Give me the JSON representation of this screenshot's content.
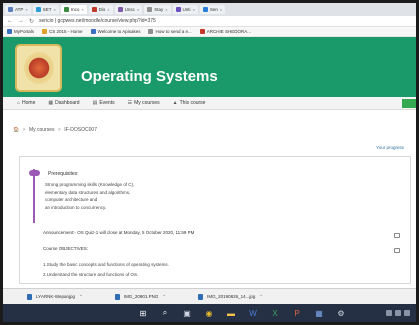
{
  "browser": {
    "tabs": [
      {
        "label": "ATP",
        "color": "#5b7fbf"
      },
      {
        "label": "SET",
        "color": "#2a9bd8"
      },
      {
        "label": "Inco",
        "color": "#3b8a3e"
      },
      {
        "label": "Dis",
        "color": "#c0392b"
      },
      {
        "label": "Unsc",
        "color": "#7d5ba6"
      },
      {
        "label": "Stay",
        "color": "#8f8f8f"
      },
      {
        "label": "Unti",
        "color": "#6c4fbf"
      },
      {
        "label": "Sen",
        "color": "#2a7fd8"
      }
    ],
    "url": "sericio | gcpwes.net/moodle/course/view.php?id=375",
    "bookmarks": [
      {
        "label": "MyPortals",
        "color": "#3b6fc2"
      },
      {
        "label": "CS 2015 - Home",
        "color": "#e0a12a"
      },
      {
        "label": "Welcome to Apisakes",
        "color": "#3b6fc2"
      },
      {
        "label": "How to send a e...",
        "color": "#8f8f8f"
      },
      {
        "label": "ARCHIE SHEDORA...",
        "color": "#c0392b"
      }
    ]
  },
  "course": {
    "title": "Operating Systems",
    "brand_color": "#1a9a6a"
  },
  "coursenav": {
    "items": [
      {
        "label": "Home",
        "icon": "home-icon"
      },
      {
        "label": "Dashboard",
        "icon": "dashboard-icon"
      },
      {
        "label": "Events",
        "icon": "calendar-icon"
      },
      {
        "label": "My courses",
        "icon": "courses-icon"
      },
      {
        "label": "This course",
        "icon": "course-icon"
      }
    ]
  },
  "breadcrumb": {
    "items": [
      "My courses",
      "IF-DOSOC007"
    ]
  },
  "progress_link": "Your progress",
  "content": {
    "prereq_title": "Prerequisites:",
    "prereq_items": [
      "Strong programming skills (Knowledge of C),",
      "elementary data structures and algorithms,",
      "computer architecture and",
      "an introduction to concurrency."
    ],
    "announcement": "Announcement:- OS Quiz-1 will close at Monday, 5 October 2020, 11:59 PM",
    "objectives_title": "Course OBJECTIVES:",
    "objectives": [
      "1.Study the basic concepts and functions of operating systems.",
      "2.Understand the structure and functions of OS."
    ]
  },
  "downloads": [
    {
      "name": "LYARNK-Wepanjpg"
    },
    {
      "name": "IMG_20901.PNG"
    },
    {
      "name": "IMG_20190826_14...jpg"
    }
  ],
  "taskbar": {
    "icons": [
      "windows-start-icon",
      "search-icon",
      "task-view-icon",
      "chrome-icon",
      "file-explorer-icon",
      "word-icon",
      "excel-icon",
      "powerpoint-icon",
      "calendar-icon",
      "settings-icon"
    ]
  }
}
